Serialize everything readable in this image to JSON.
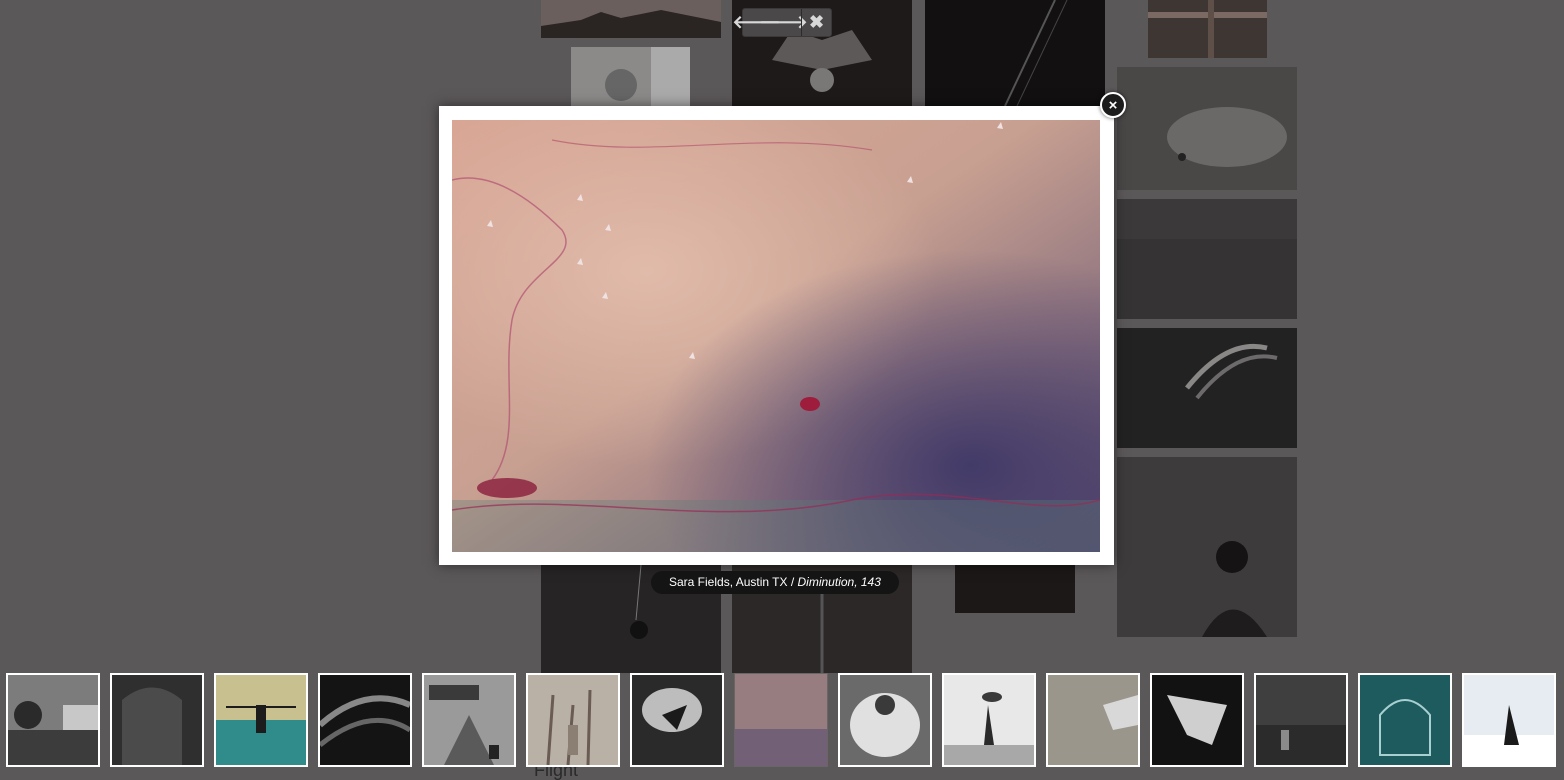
{
  "gallery": {
    "page_heading": "Flight"
  },
  "toolbar": {
    "prev_label": "🡐",
    "next_label": "🡒",
    "close_label": "✖"
  },
  "lightbox": {
    "close_label": "×",
    "caption": {
      "artist": "Sara Fields, Austin TX",
      "separator": " / ",
      "title": "Diminution, 143"
    }
  },
  "thumbnails": [
    {
      "subject": "Landscape with trees and road"
    },
    {
      "subject": "Dark arch wall"
    },
    {
      "subject": "Woman with outstretched arms in water"
    },
    {
      "subject": "Insect wing close-up"
    },
    {
      "subject": "Hand over road with car"
    },
    {
      "subject": "Figure among bare trees"
    },
    {
      "subject": "Bird in bright cloud"
    },
    {
      "subject": "Diminution, 143 (current)"
    },
    {
      "subject": "Glowing figure with wings"
    },
    {
      "subject": "Figure lifting dog on beach"
    },
    {
      "subject": "Airplane wing in sky"
    },
    {
      "subject": "Bat wing under light"
    },
    {
      "subject": "Misty dark landscape"
    },
    {
      "subject": "Teal birdcage"
    },
    {
      "subject": "Figure in snow"
    }
  ],
  "active_thumbnail": 7,
  "colors": {
    "backdrop": "#5b5859",
    "caption_bg": "#141414",
    "frame": "#ffffff"
  }
}
